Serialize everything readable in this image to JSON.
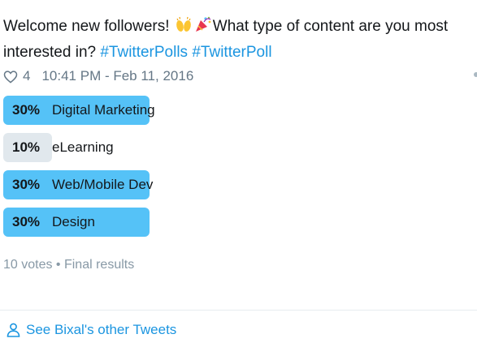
{
  "tweet": {
    "text_intro": "Welcome new followers!",
    "emoji_1": "raising-hands-emoji",
    "emoji_2": "party-popper-emoji",
    "text_question": "What type of content are you most interested in?",
    "hashtags": [
      "#TwitterPolls",
      "#TwitterPoll"
    ]
  },
  "meta": {
    "like_icon": "heart-outline-icon",
    "like_count": "4",
    "timestamp": "10:41 PM - Feb 11, 2016"
  },
  "poll": {
    "choices": [
      {
        "percent_label": "30%",
        "label": "Digital Marketing",
        "fraction": 0.3,
        "leading": true
      },
      {
        "percent_label": "10%",
        "label": "eLearning",
        "fraction": 0.1,
        "leading": false
      },
      {
        "percent_label": "30%",
        "label": "Web/Mobile Dev",
        "fraction": 0.3,
        "leading": true
      },
      {
        "percent_label": "30%",
        "label": "Design",
        "fraction": 0.3,
        "leading": true
      }
    ],
    "footer": "10 votes • Final results"
  },
  "footer_link": {
    "icon": "person-outline-icon",
    "label": "See Bixal's other Tweets"
  },
  "colors": {
    "hashtag": "#1b95e0",
    "bar_leading": "#55c2f7",
    "bar_other": "#e1e8ed",
    "meta_text": "#657786"
  }
}
